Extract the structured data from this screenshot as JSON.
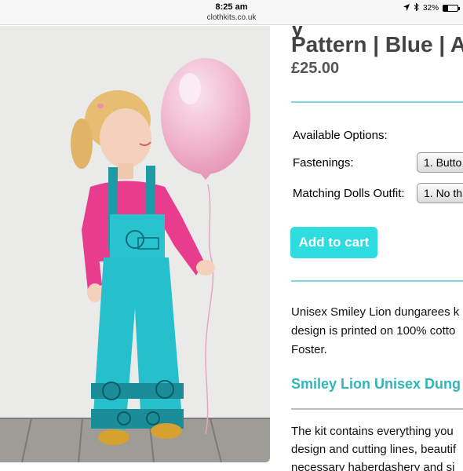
{
  "status_bar": {
    "time": "8:25 am",
    "url": "clothkits.co.uk",
    "battery": "32%",
    "battery_level": 0.32
  },
  "product": {
    "title_fragment_top": "y",
    "title": "Pattern | Blue | A",
    "price": "£25.00",
    "options": {
      "heading": "Available Options:",
      "fastenings_label": "Fastenings:",
      "fastenings_value": "1. Butto",
      "dolls_label": "Matching Dolls Outfit:",
      "dolls_value": "1. No th"
    },
    "add_to_cart": "Add to cart",
    "description_lines": [
      "Unisex Smiley Lion dungarees k",
      "design is printed on 100% cotto",
      "Foster."
    ],
    "subheading": "Smiley Lion Unisex Dung",
    "kit_lines": [
      "The kit contains everything you",
      "design and cutting lines, beautif",
      "necessary haberdashery and si"
    ]
  },
  "colors": {
    "accent": "#2fdde1",
    "subheading": "#2fb5ba",
    "divider": "#7fd9df"
  }
}
